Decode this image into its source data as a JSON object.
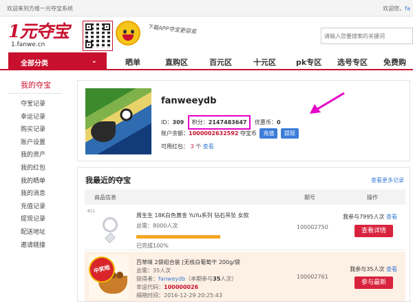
{
  "topbar": {
    "welcome": "欢迎来到方维一元夺宝系统",
    "greeting": "欢迎您，",
    "user": "fa"
  },
  "header": {
    "logo_mark": "1元夺宝",
    "logo_url": "1.fanwe.cn",
    "slogan": "下载APP夺宝更容易",
    "search_placeholder": "请输入您要搜索的关键词"
  },
  "nav": {
    "category": "全部分类",
    "items": [
      "晒单",
      "直购区",
      "百元区",
      "十元区",
      "pk专区",
      "选号专区",
      "免费购"
    ]
  },
  "sidebar": {
    "title": "我的夺宝",
    "links": [
      "夺宝记录",
      "幸运记录",
      "购买记录",
      "账户设置",
      "我的资产",
      "我的红包",
      "我的晒单",
      "我的消息",
      "充值记录",
      "提现记录",
      "配送地址",
      "邀请链接"
    ]
  },
  "profile": {
    "username": "fanweeydb",
    "id_label": "ID：",
    "id_value": "309",
    "points_label": "积分：",
    "points_value": "2147483647",
    "coupon_label": "优惠币：",
    "coupon_value": "0",
    "balance_label": "账户余额：",
    "balance_value": "1000002632592",
    "balance_unit": "夺宝币",
    "recharge_button": "充值",
    "withdraw_button": "提现",
    "redpack_label": "可用红包：",
    "redpack_value": "3",
    "redpack_unit": "个",
    "redpack_view": "查看"
  },
  "recent": {
    "title": "我最近的夺宝",
    "more_link": "查看更多记录",
    "columns": [
      "商品信息",
      "期号",
      "操作"
    ],
    "rows": [
      {
        "corner_label": "811",
        "name": "周生生 18K白色黄金 YuYu系列 钻石吊坠 女款",
        "total": "总需：8000人次",
        "progress": 1.0,
        "progress_text": "已完成100%",
        "period": "100002750",
        "participate": "我参与7995人次",
        "view_link": "查看",
        "button": "查看详情"
      },
      {
        "badge": "中奖啦",
        "name": "百草味 2袋组合装 [无核白葡萄干 200g/袋",
        "total": "总需：35人次",
        "winner_label": "获得者：",
        "winner": "fanweydb",
        "winner_note_a": "（本期参与",
        "winner_count": "35",
        "winner_note_b": "人次）",
        "lucky_label": "幸运代码：",
        "lucky_code": "100000026",
        "time_label": "揭晓时间：",
        "time": "2016-12-29 20:25:43",
        "period": "100002761",
        "participate": "我参与35人次",
        "view_link": "查看",
        "button": "参与最新"
      }
    ]
  },
  "colors": {
    "brand": "#c8102e",
    "link": "#3a7ad5",
    "highlight": "#e600c8",
    "progress": "#f5a623",
    "button_blue": "#3b7dd8",
    "button_red": "#d9233e"
  },
  "icons": {
    "category_toggle": "chevron-down-icon",
    "mascot": "smiley-icon",
    "qr": "qr-code-icon",
    "annotation": "arrow-icon"
  }
}
